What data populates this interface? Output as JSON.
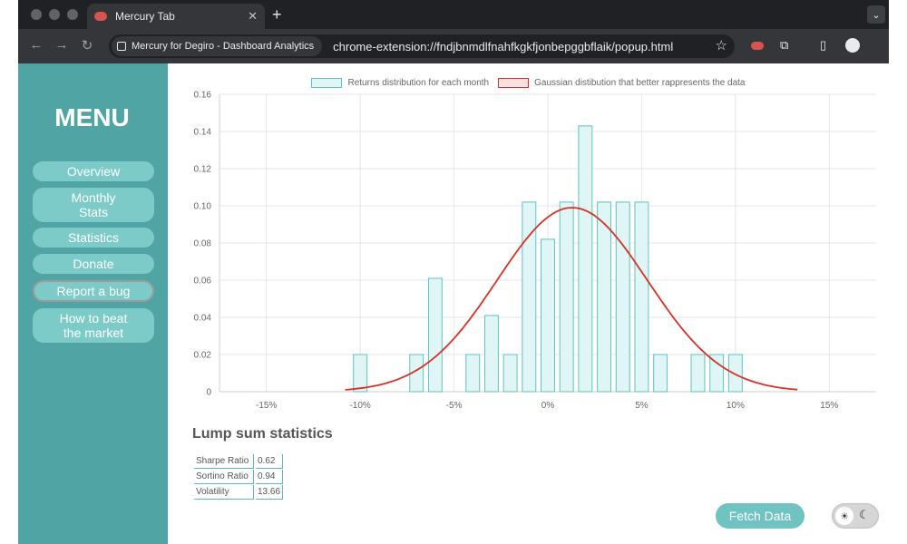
{
  "browser": {
    "tab_title": "Mercury Tab",
    "tab_close": "✕",
    "new_tab": "+",
    "tab_menu": "⌄",
    "site_chip": "Mercury for Degiro - Dashboard Analytics",
    "url": "chrome-extension://fndjbnmdlfnahfkgkfjonbepggbflaik/popup.html",
    "icons": {
      "back": "back-arrow-icon",
      "forward": "forward-arrow-icon",
      "reload": "reload-icon",
      "bookmark": "star-icon",
      "extensions": "puzzle-icon",
      "profile": "profile-icon"
    },
    "glyphs": {
      "back": "←",
      "forward": "→",
      "reload": "↻",
      "star": "☆",
      "puzzle": "⧉",
      "sidepanel": "▯"
    }
  },
  "sidebar": {
    "title": "MENU",
    "items": [
      {
        "label": "Overview"
      },
      {
        "label": "Monthly\nStats"
      },
      {
        "label": "Statistics"
      },
      {
        "label": "Donate"
      },
      {
        "label": "Report a bug"
      },
      {
        "label": "How to beat\nthe market"
      }
    ]
  },
  "legend": {
    "series1": "Returns distribution for each month",
    "series2": "Gaussian distibution that better rappresents the data"
  },
  "colors": {
    "accent": "#50a5a4",
    "bar_fill": "#e0f5f5",
    "bar_stroke": "#5fc2c2",
    "curve": "#d93025"
  },
  "chart_data": {
    "type": "bar",
    "title": "",
    "xlabel": "",
    "ylabel": "",
    "x_range": [
      -17.5,
      17.5
    ],
    "x_ticks": [
      "-15%",
      "-10%",
      "-5%",
      "0%",
      "5%",
      "10%",
      "15%"
    ],
    "x_tick_values": [
      -15,
      -10,
      -5,
      0,
      5,
      10,
      15
    ],
    "ylim": [
      0,
      0.16
    ],
    "y_ticks": [
      "0",
      "0.02",
      "0.04",
      "0.06",
      "0.08",
      "0.10",
      "0.12",
      "0.14",
      "0.16"
    ],
    "y_tick_values": [
      0,
      0.02,
      0.04,
      0.06,
      0.08,
      0.1,
      0.12,
      0.14,
      0.16
    ],
    "grid": true,
    "legend_position": "top",
    "bars": {
      "name": "Returns distribution for each month",
      "x": [
        -10,
        -7,
        -6,
        -4,
        -3,
        -2,
        -1,
        0,
        1,
        2,
        3,
        4,
        5,
        6,
        8,
        9,
        10
      ],
      "values": [
        0.02,
        0.02,
        0.061,
        0.02,
        0.041,
        0.02,
        0.102,
        0.082,
        0.102,
        0.143,
        0.102,
        0.102,
        0.102,
        0.02,
        0.02,
        0.02,
        0.02
      ]
    },
    "curve": {
      "name": "Gaussian distibution that better rappresents the data",
      "mean": 1.3,
      "peak": 0.099,
      "std_dev": 4.0,
      "x_range": [
        -10.8,
        13.3
      ]
    }
  },
  "stats": {
    "title": "Lump sum statistics",
    "rows": [
      {
        "label": "Sharpe Ratio",
        "value": "0.62"
      },
      {
        "label": "Sortino Ratio",
        "value": "0.94"
      },
      {
        "label": "Volatility",
        "value": "13.66"
      }
    ]
  },
  "actions": {
    "fetch_label": "Fetch Data",
    "theme_sun": "☀",
    "theme_moon": "☾"
  }
}
